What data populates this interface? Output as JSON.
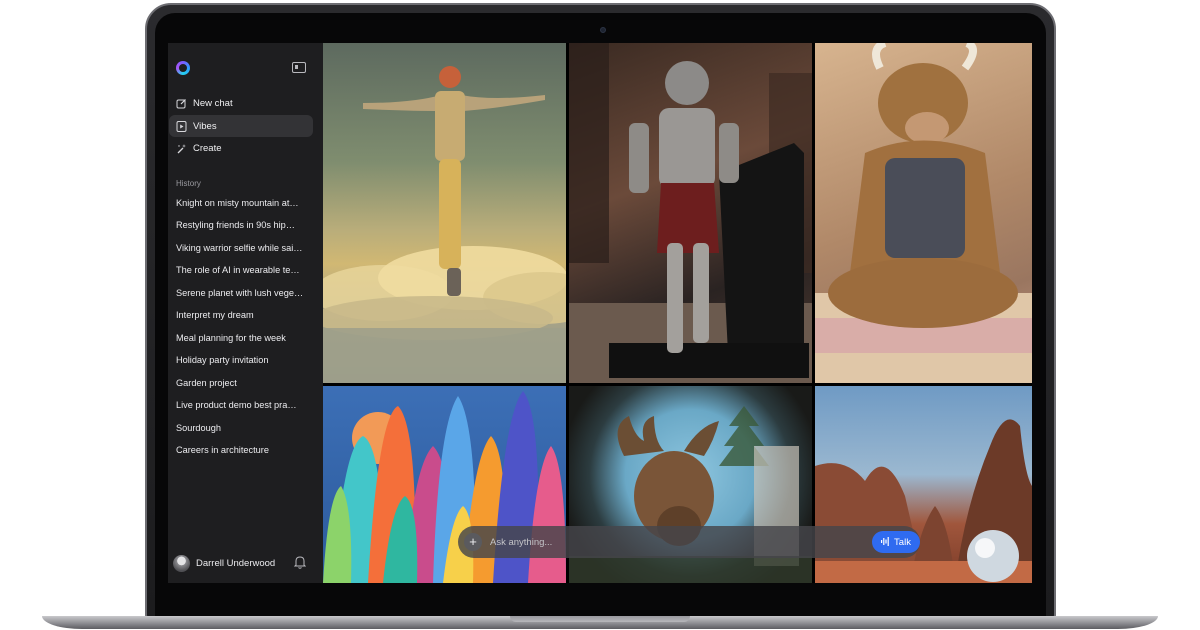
{
  "sidebar": {
    "nav": [
      {
        "label": "New chat",
        "icon": "edit-icon"
      },
      {
        "label": "Vibes",
        "icon": "play-icon",
        "active": true
      },
      {
        "label": "Create",
        "icon": "magic-wand-icon"
      }
    ],
    "history_label": "History",
    "history": [
      "Knight on misty mountain at…",
      "Restyling friends in 90s hip…",
      "Viking warrior selfie while sai…",
      "The role of AI in wearable te…",
      "Serene planet with lush vege…",
      "Interpret my dream",
      "Meal planning for the week",
      "Holiday party invitation",
      "Garden project",
      "Live product demo best pra…",
      "Sourdough",
      "Careers in architecture"
    ],
    "user_name": "Darrell Underwood"
  },
  "ask": {
    "placeholder": "Ask anything...",
    "talk_label": "Talk"
  },
  "colors": {
    "sidebar_bg": "#1e1e20",
    "active_item": "#333336",
    "talk_button": "#2f6bf0"
  }
}
